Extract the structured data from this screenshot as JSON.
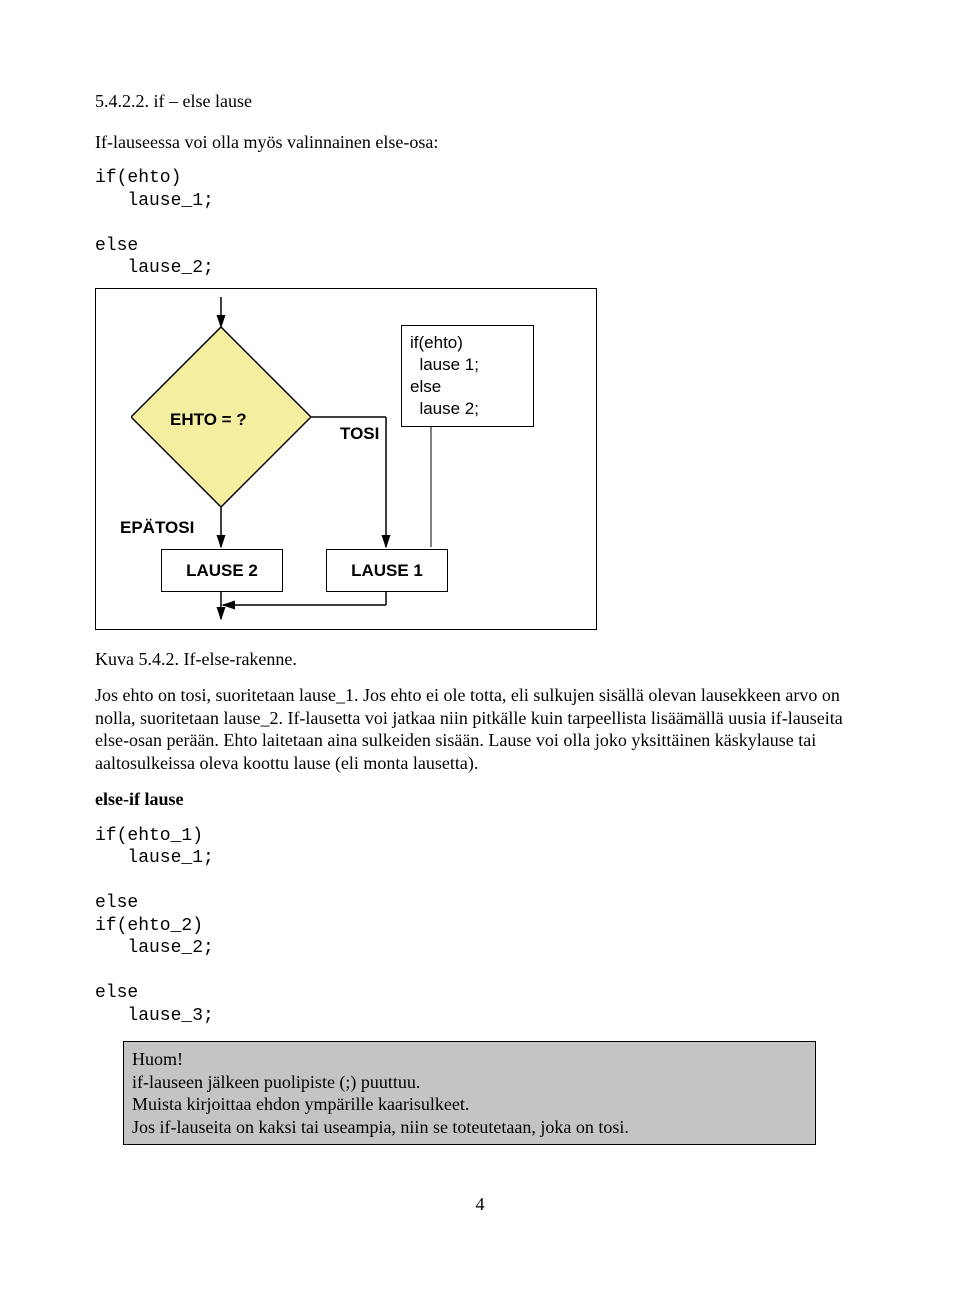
{
  "section": {
    "number": "5.4.2.2.",
    "title": "if – else lause"
  },
  "intro": "If-lauseessa voi olla myös valinnainen else-osa:",
  "code1": {
    "l1": "if(ehto)",
    "l2": "   lause_1;",
    "l3": "",
    "l4": "else",
    "l5": "   lause_2;"
  },
  "diagram": {
    "cond": "EHTO = ?",
    "true_label": "TOSI",
    "false_label": "EPÄTOSI",
    "box_lause2": "LAUSE 2",
    "box_lause1": "LAUSE 1",
    "codebox": {
      "l1": "if(ehto)",
      "l2": "  lause 1;",
      "l3": "else",
      "l4": "  lause 2;"
    }
  },
  "caption": "Kuva 5.4.2. If-else-rakenne.",
  "para1": "Jos ehto on tosi, suoritetaan lause_1. Jos ehto ei ole totta, eli sulkujen sisällä olevan lausekkeen arvo on nolla, suoritetaan lause_2. If-lausetta voi jatkaa niin pitkälle kuin tarpeellista lisäämällä uusia if-lauseita else-osan perään. Ehto laitetaan aina sulkeiden sisään. Lause voi olla joko yksittäinen käskylause tai aaltosulkeissa oleva koottu lause (eli monta lausetta).",
  "subheading": "else-if lause",
  "code2": {
    "l1": "if(ehto_1)",
    "l2": "   lause_1;",
    "l3": "",
    "l4": "else",
    "l5": "if(ehto_2)",
    "l6": "   lause_2;",
    "l7": "",
    "l8": "else",
    "l9": "   lause_3;"
  },
  "hint": {
    "l1": "Huom!",
    "l2": "if-lauseen jälkeen puolipiste (;) puuttuu.",
    "l3": "Muista kirjoittaa ehdon ympärille kaarisulkeet.",
    "l4": "Jos if-lauseita on kaksi tai useampia, niin se toteutetaan, joka on tosi."
  },
  "pagenum": "4"
}
